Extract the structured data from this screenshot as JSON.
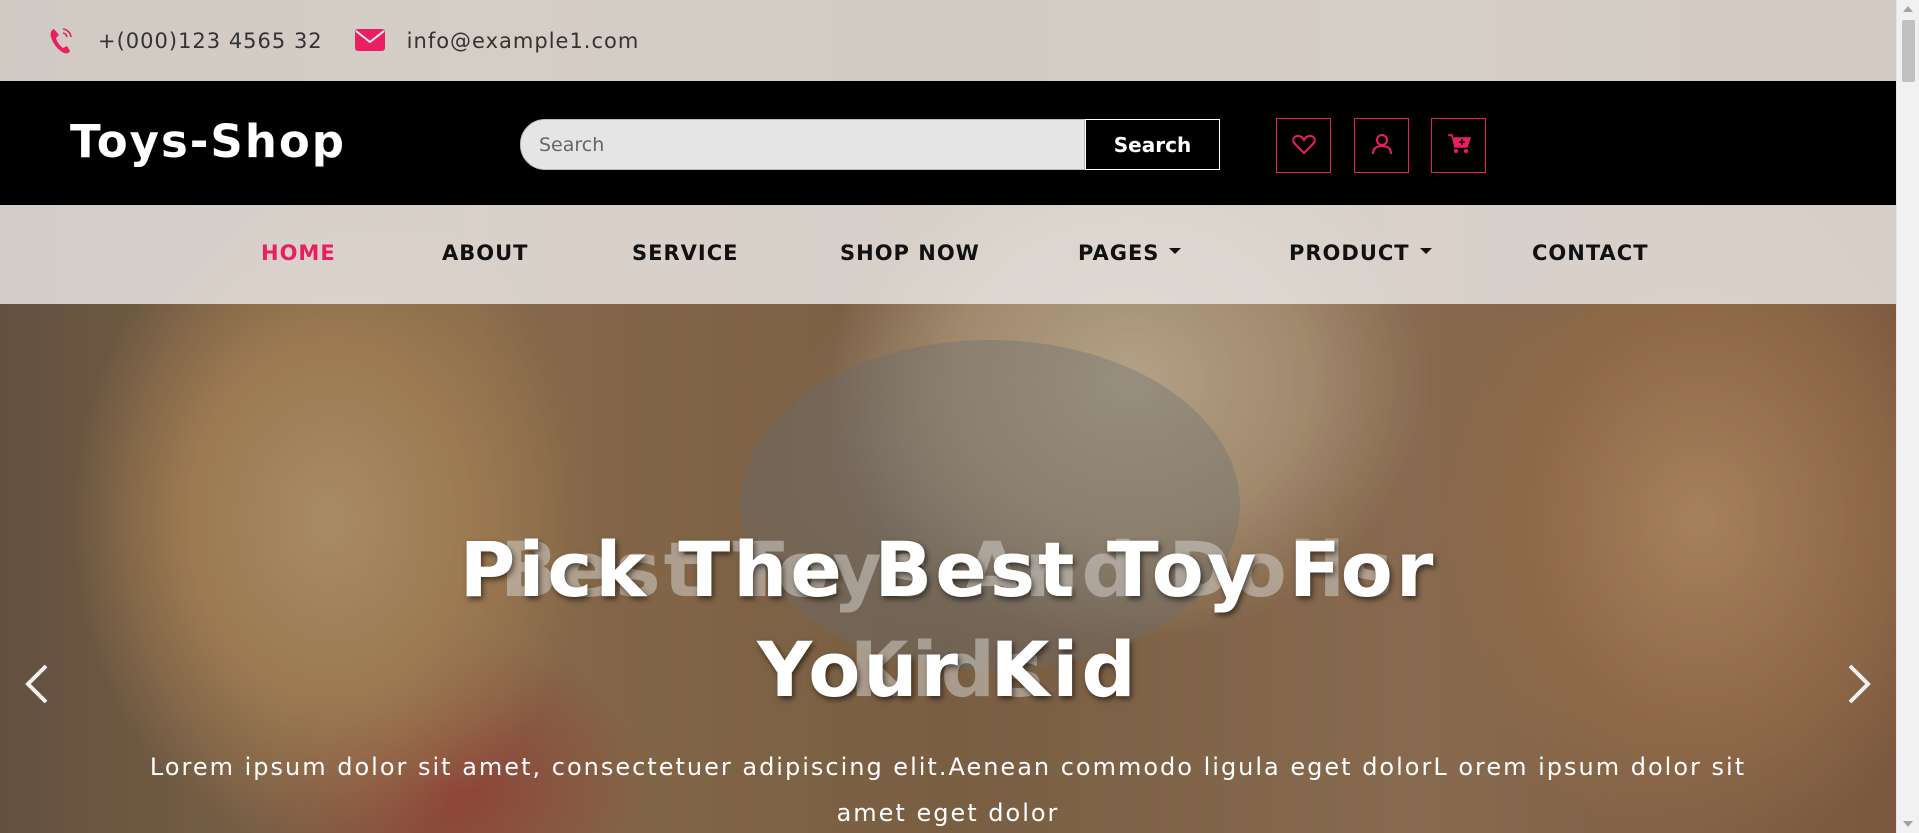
{
  "topbar": {
    "phone": "+(000)123 4565 32",
    "email": "info@example1.com"
  },
  "header": {
    "logo": "Toys-Shop",
    "search_placeholder": "Search",
    "search_button": "Search"
  },
  "nav": {
    "items": [
      {
        "label": "HOME"
      },
      {
        "label": "ABOUT"
      },
      {
        "label": "SERVICE"
      },
      {
        "label": "SHOP NOW"
      },
      {
        "label": "PAGES"
      },
      {
        "label": "PRODUCT"
      },
      {
        "label": "CONTACT"
      }
    ]
  },
  "hero": {
    "title_line1": "Pick The Best Toy For",
    "title_line2": "Your Kid",
    "ghost_line1": "Best Toys And Dolls",
    "ghost_line2": "Kids",
    "text": "Lorem ipsum dolor sit amet, consectetuer adipiscing elit.Aenean commodo ligula eget dolorL orem ipsum dolor sit amet eget dolor"
  },
  "colors": {
    "accent": "#e91e63",
    "header_bg": "#000000"
  },
  "icons": [
    "phone-icon",
    "envelope-icon",
    "heart-icon",
    "user-icon",
    "cart-icon",
    "chevron-left-icon",
    "chevron-right-icon"
  ]
}
